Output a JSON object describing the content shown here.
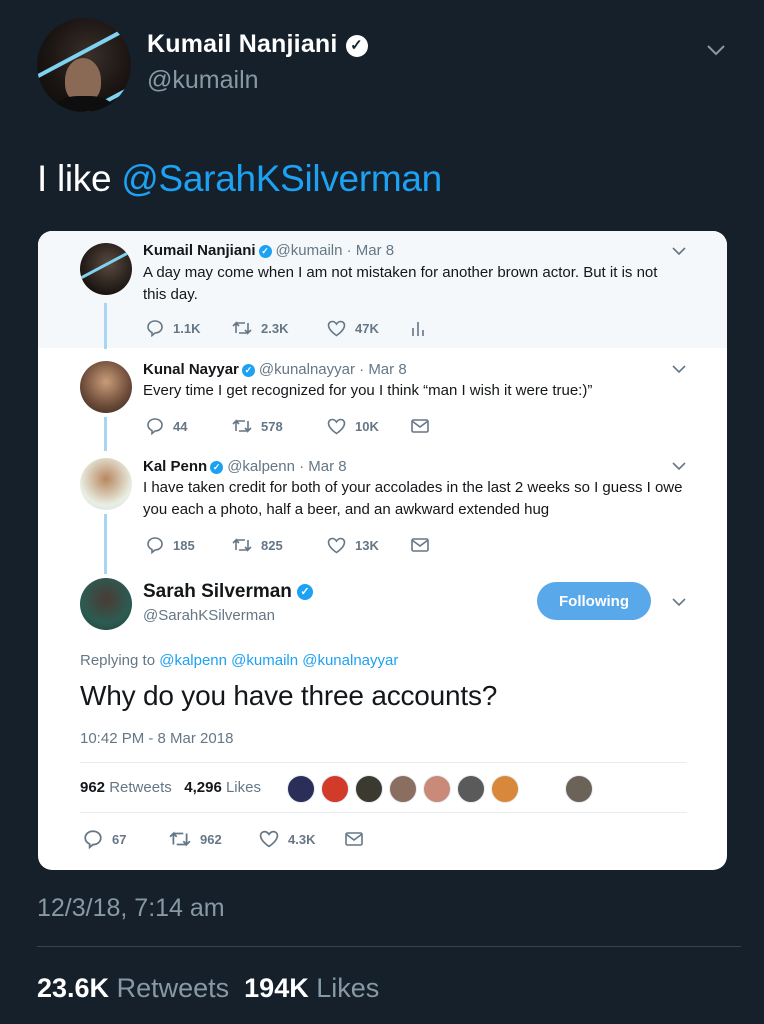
{
  "outer_tweet": {
    "name": "Kumail Nanjiani",
    "handle": "@kumailn",
    "text_prefix": "I like ",
    "text_mention": "@SarahKSilverman",
    "date": "12/3/18, 7:14 am",
    "retweets_count": "23.6K",
    "retweets_label": "Retweets",
    "likes_count": "194K",
    "likes_label": "Likes"
  },
  "thread": [
    {
      "name": "Kumail Nanjiani",
      "meta": "@kumailn · Mar 8",
      "text": "A day may come when I am not mistaken for another brown actor. But it is not this day.",
      "replies": "1.1K",
      "retweets": "2.3K",
      "likes": "47K",
      "last_icon": "analytics-icon"
    },
    {
      "name": "Kunal Nayyar",
      "meta": "@kunalnayyar · Mar 8",
      "text": "Every time I get recognized for you I think “man I wish it were true:)”",
      "replies": "44",
      "retweets": "578",
      "likes": "10K",
      "last_icon": "message-icon"
    },
    {
      "name": "Kal Penn",
      "meta": "@kalpenn · Mar 8",
      "text": "I have taken credit for both of your accolades in the last 2 weeks so I guess I owe you each a photo, half a beer, and an awkward extended hug",
      "replies": "185",
      "retweets": "825",
      "likes": "13K",
      "last_icon": "message-icon"
    }
  ],
  "main_tweet": {
    "name": "Sarah Silverman",
    "handle": "@SarahKSilverman",
    "follow_label": "Following",
    "replying_prefix": "Replying to",
    "replying_mentions": "@kalpenn @kumailn @kunalnayyar",
    "text": "Why do you have three accounts?",
    "timestamp": "10:42 PM - 8 Mar 2018",
    "retweets_count": "962",
    "retweets_label": "Retweets",
    "likes_count": "4,296",
    "likes_label": "Likes",
    "replies": "67",
    "retweets": "962",
    "likes": "4.3K"
  },
  "colors": {
    "background": "#15202b",
    "accent": "#1da1f2",
    "follow_button": "#58a8ea"
  }
}
